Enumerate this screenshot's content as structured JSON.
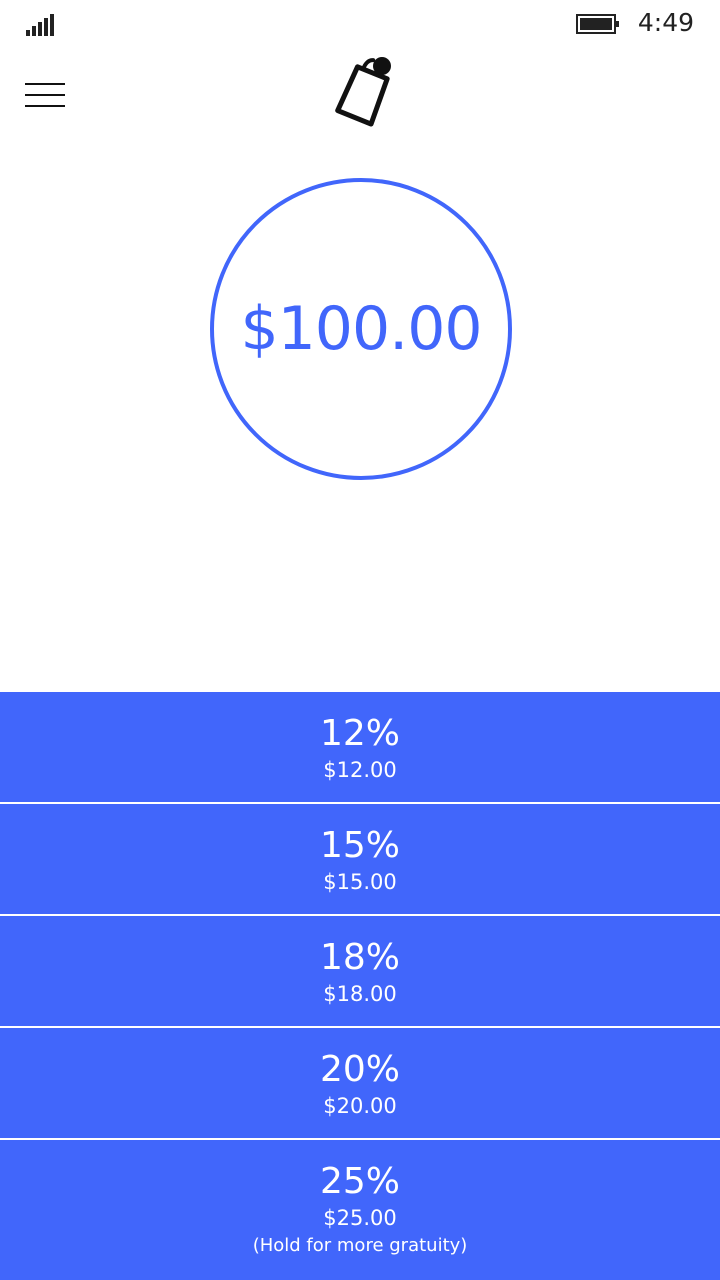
{
  "status_bar": {
    "time": "4:49",
    "icons": [
      "signal-icon",
      "battery-icon"
    ]
  },
  "header": {
    "icons": [
      "hamburger-menu-icon",
      "price-tag-icon"
    ]
  },
  "bill": {
    "amount": "$100.00"
  },
  "tips": [
    {
      "percent": "12%",
      "amount": "$12.00"
    },
    {
      "percent": "15%",
      "amount": "$15.00"
    },
    {
      "percent": "18%",
      "amount": "$18.00"
    },
    {
      "percent": "20%",
      "amount": "$20.00"
    },
    {
      "percent": "25%",
      "amount": "$25.00",
      "hint": "(Hold for more gratuity)"
    }
  ],
  "colors": {
    "accent": "#4166fb",
    "background": "#ffffff",
    "tip_text": "#ffffff"
  }
}
